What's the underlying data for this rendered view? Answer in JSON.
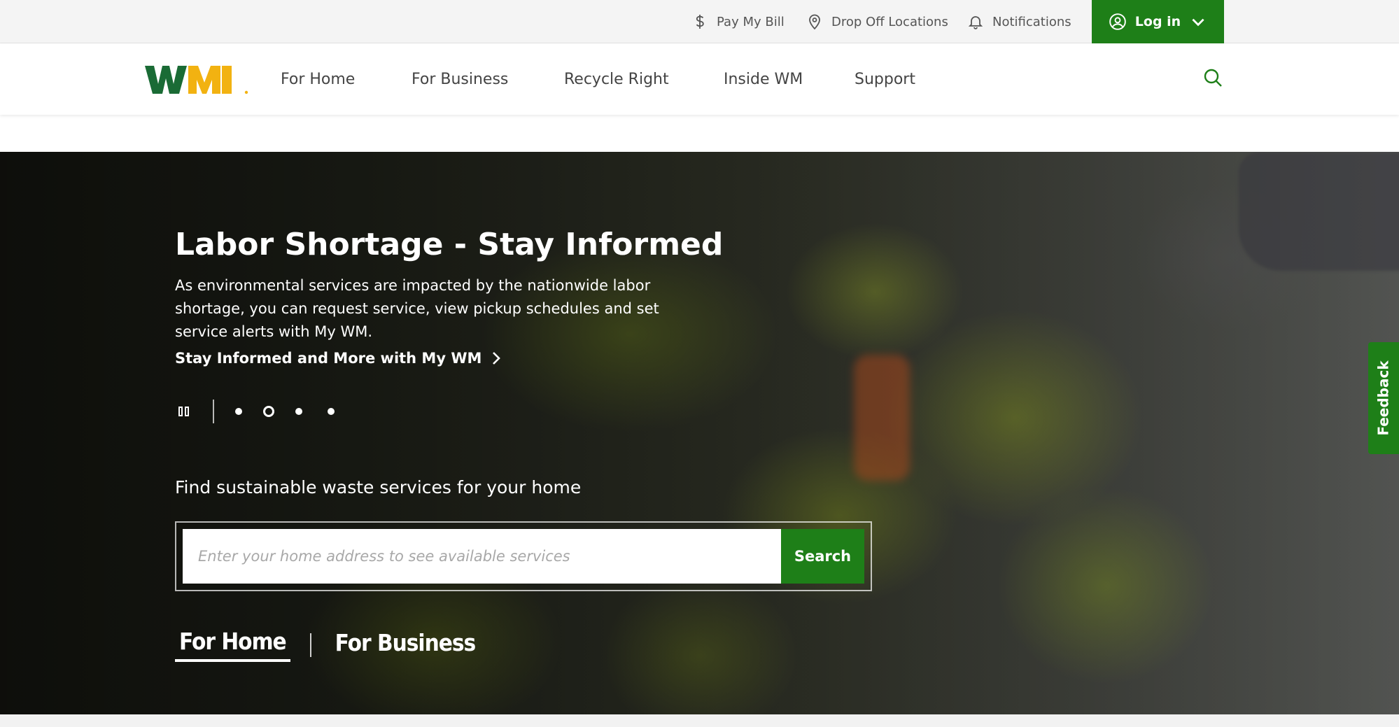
{
  "utility_bar": {
    "pay_bill": "Pay My Bill",
    "drop_off": "Drop Off Locations",
    "notifications": "Notifications",
    "login": "Log in"
  },
  "main_nav": {
    "logo_text": "WM",
    "items": [
      "For Home",
      "For Business",
      "Recycle Right",
      "Inside WM",
      "Support"
    ]
  },
  "hero": {
    "title": "Labor Shortage - Stay Informed",
    "description": "As environmental services are impacted by the nationwide labor shortage, you can request service, view pickup schedules and set service alerts with My WM.",
    "cta": "Stay Informed and More with My WM",
    "carousel": {
      "slides": 4,
      "active_index": 1
    },
    "search_label": "Find sustainable waste services for your home",
    "search_placeholder": "Enter your home address to see available services",
    "search_button": "Search",
    "tabs": [
      "For Home",
      "For Business"
    ],
    "active_tab": "For Home"
  },
  "feedback_label": "Feedback",
  "colors": {
    "brand_green": "#1e7f18",
    "logo_green": "#1a6b35",
    "logo_yellow": "#f2b211"
  },
  "icons": [
    "dollar-icon",
    "location-pin-icon",
    "bell-icon",
    "user-circle-icon",
    "chevron-down-icon",
    "search-icon",
    "chevron-right-icon",
    "pause-icon"
  ]
}
